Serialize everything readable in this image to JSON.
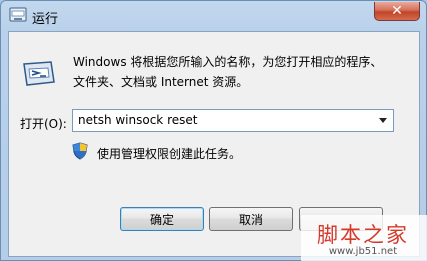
{
  "window": {
    "title": "运行",
    "close_symbol": "✕",
    "title_icon": "run-app-icon"
  },
  "dialog": {
    "description_line1": "Windows 将根据您所输入的名称，为您打开相应的程序、",
    "description_line2": "文件夹、文档或 Internet 资源。",
    "open_label": "打开(O):",
    "command_value": "netsh winsock reset",
    "admin_note": "使用管理权限创建此任务。",
    "dropdown_icon": "chevron-down-icon",
    "shield_icon": "uac-shield-icon"
  },
  "buttons": {
    "ok": "确定",
    "cancel": "取消",
    "browse": ""
  },
  "watermark": {
    "logo": "脚本之家",
    "url": "www.jb51.net"
  },
  "colors": {
    "frame": "#b9d1ea",
    "close_button": "#c0452a",
    "client": "#f0f0f0",
    "watermark": "#d43a2a"
  }
}
